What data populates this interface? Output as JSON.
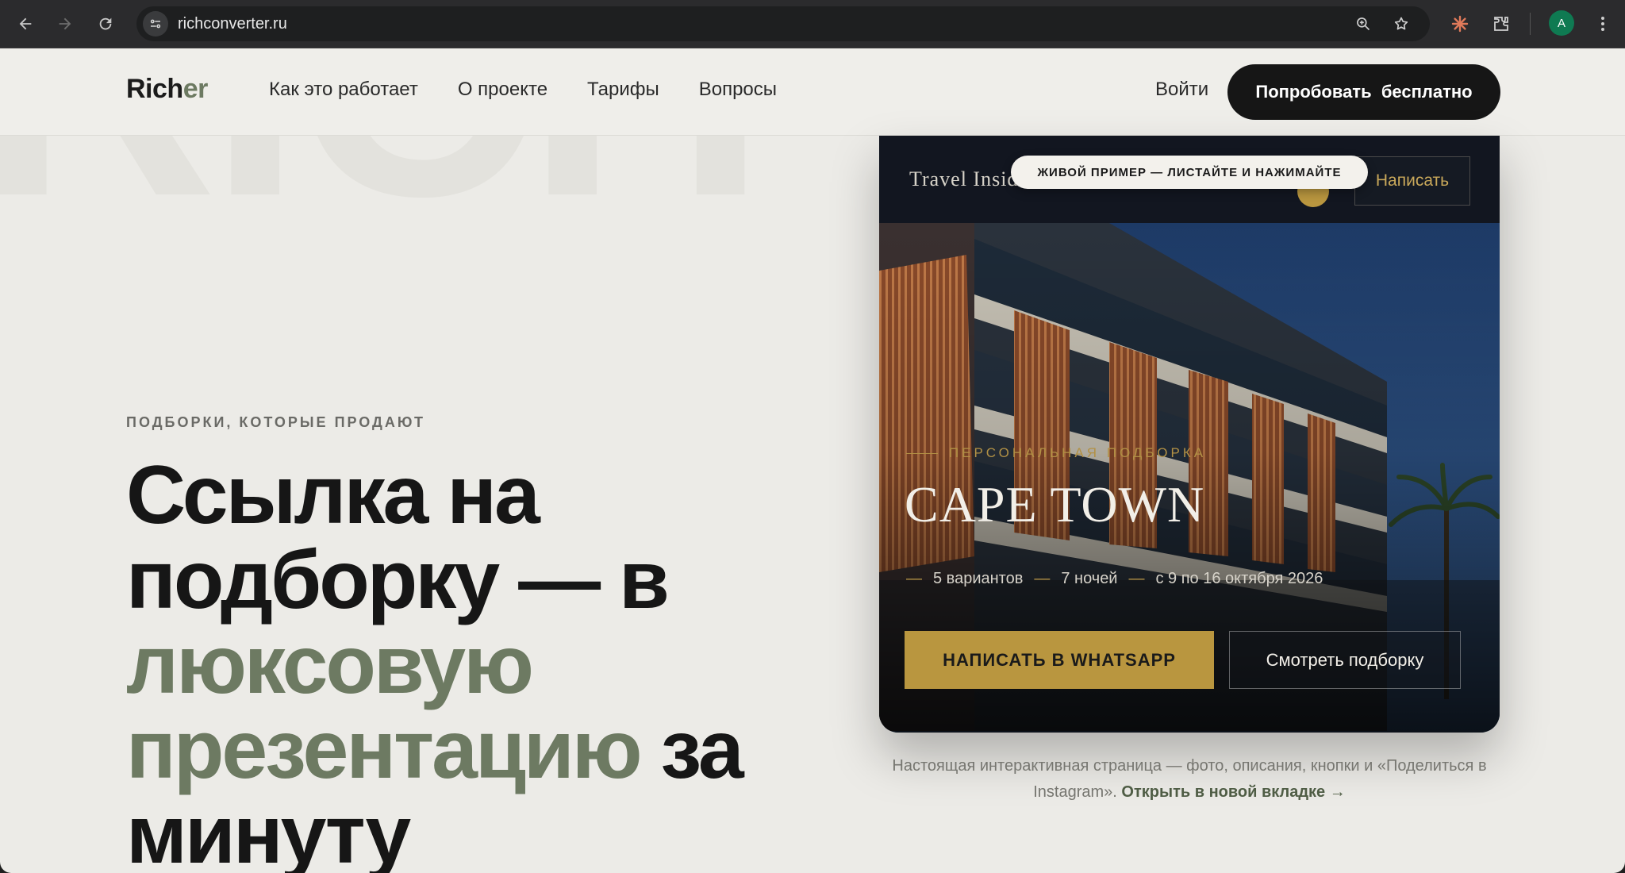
{
  "browser": {
    "url": "richconverter.ru",
    "avatar_letter": "A"
  },
  "site": {
    "logo_main": "Rich",
    "logo_accent": "er",
    "nav": [
      "Как это работает",
      "О проекте",
      "Тарифы",
      "Вопросы"
    ],
    "login": "Войти",
    "cta": "Попробовать  бесплатно",
    "watermark": "RICH"
  },
  "hero": {
    "eyebrow": "ПОДБОРКИ, КОТОРЫЕ ПРОДАЮТ",
    "line1": "Ссылка на",
    "line2": "подборку — в",
    "line3_accent": "люксовую",
    "line4_accent": "презентацию",
    "line4_rest": " за",
    "line5": "минуту"
  },
  "demo": {
    "live_label": "ЖИВОЙ ПРИМЕР — ЛИСТАЙТЕ И НАЖИМАЙТЕ",
    "brand": "Travel Inside",
    "write_button": "Написать",
    "eyebrow": "ПЕРСОНАЛЬНАЯ ПОДБОРКА",
    "title": "CAPE TOWN",
    "meta": [
      "5 вариантов",
      "7 ночей",
      "с 9 по 16 октября 2026"
    ],
    "whatsapp_button": "НАПИСАТЬ В WHATSAPP",
    "view_button": "Смотреть подборку"
  },
  "caption": {
    "text": "Настоящая интерактивная страница — фото, описания, кнопки и «Поделиться в Instagram».",
    "link": "Открыть в новой вкладке →"
  },
  "colors": {
    "accent_green": "#6d7a62",
    "gold": "#b9963f",
    "dark": "#161616",
    "page_bg": "#ecebe7"
  }
}
